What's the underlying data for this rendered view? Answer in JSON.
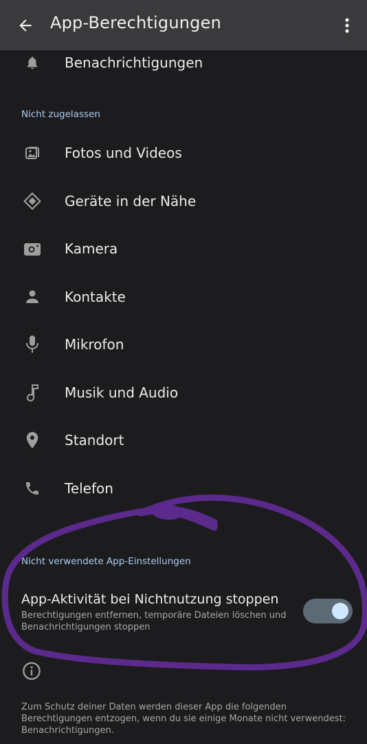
{
  "header": {
    "title": "App-Berechtigungen",
    "back_icon": "arrow-back-icon",
    "more_icon": "more-vert-icon"
  },
  "allowed": {
    "items": [
      {
        "label": "Benachrichtigungen",
        "icon": "bell-icon"
      }
    ]
  },
  "not_allowed": {
    "section_label": "Nicht zugelassen",
    "items": [
      {
        "label": "Fotos und Videos",
        "icon": "photos-icon"
      },
      {
        "label": "Geräte in der Nähe",
        "icon": "nearby-devices-icon"
      },
      {
        "label": "Kamera",
        "icon": "camera-icon"
      },
      {
        "label": "Kontakte",
        "icon": "person-icon"
      },
      {
        "label": "Mikrofon",
        "icon": "microphone-icon"
      },
      {
        "label": "Musik und Audio",
        "icon": "music-note-icon"
      },
      {
        "label": "Standort",
        "icon": "location-pin-icon"
      },
      {
        "label": "Telefon",
        "icon": "phone-icon"
      }
    ]
  },
  "unused": {
    "section_label": "Nicht verwendete App-Einstellungen",
    "toggle_title": "App-Aktivität bei Nichtnutzung stoppen",
    "toggle_subtitle": "Berechtigungen entfernen, temporäre Dateien löschen und Benachrichtigungen stoppen",
    "toggle_on": true
  },
  "footer": {
    "info_icon": "info-icon",
    "text": "Zum Schutz deiner Daten werden dieser App die folgenden Berechtigungen entzogen, wenn du sie einige Monate nicht verwendest: Benachrichtigungen."
  },
  "colors": {
    "background": "#1c1c1e",
    "appbar": "#3a3a3d",
    "section_label": "#a9cdef",
    "icon": "#9e9e9e",
    "toggle_track": "#5c6a75",
    "toggle_knob": "#cfe8ff",
    "annotation": "#5b2a8c"
  }
}
